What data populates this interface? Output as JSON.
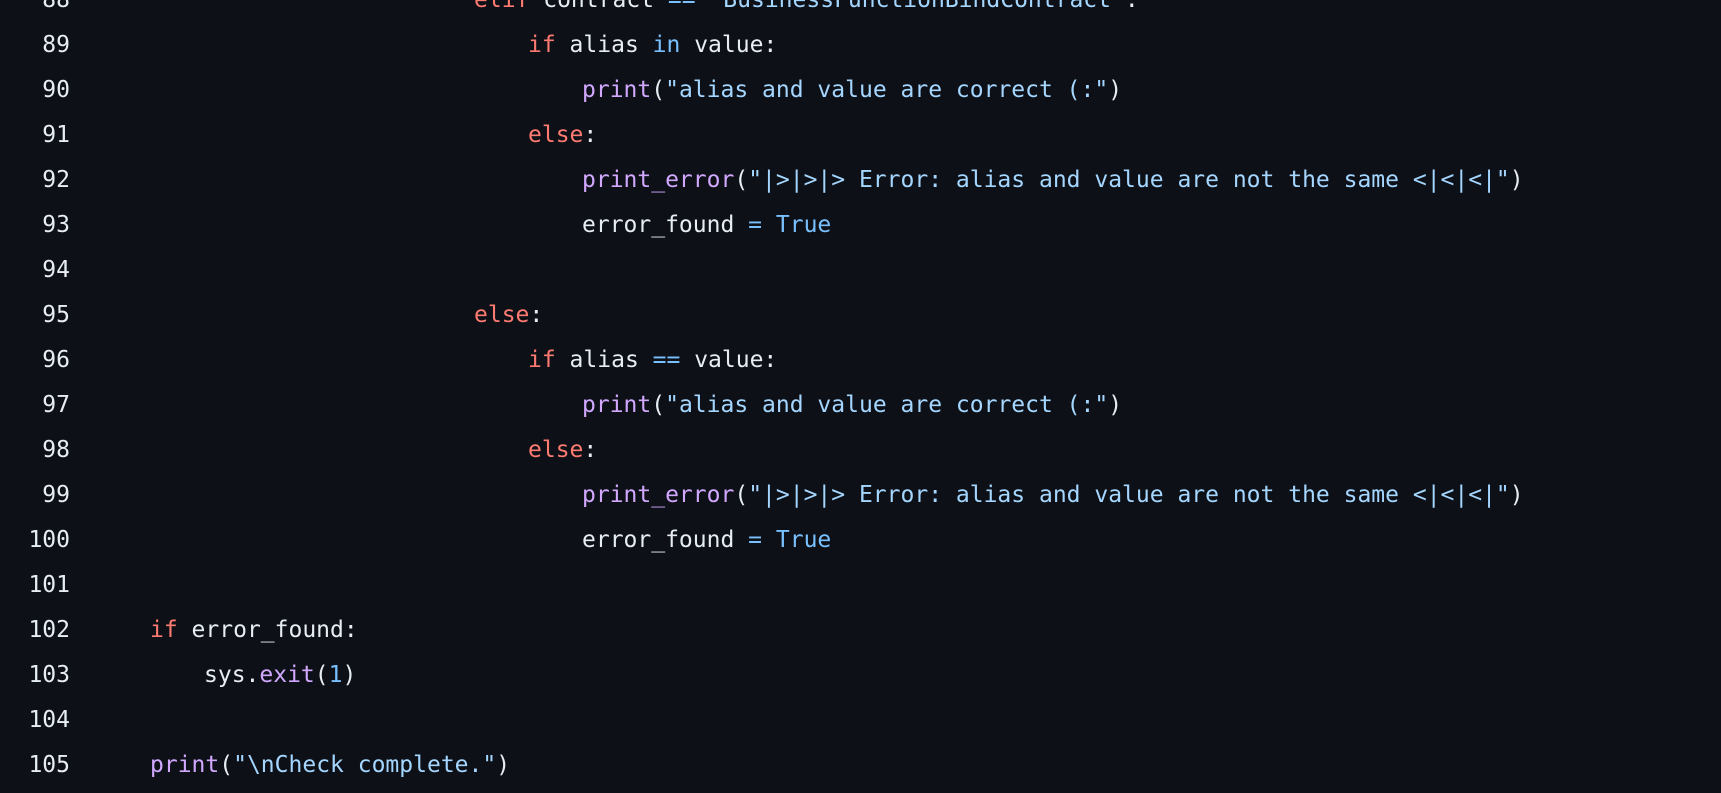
{
  "colors": {
    "background": "#0d1117",
    "text": "#e6edf3",
    "keyword": "#ff7b72",
    "function": "#d2a8ff",
    "string": "#a5d6ff",
    "constant": "#79c0ff"
  },
  "lines": [
    {
      "num": "88",
      "indent": "            ",
      "tokens": [
        [
          "kw",
          "elif"
        ],
        [
          "id",
          " contract "
        ],
        [
          "op",
          "=="
        ],
        [
          "str",
          " \"BusinessFunctionBindContract\""
        ],
        [
          "id",
          ":"
        ]
      ]
    },
    {
      "num": "89",
      "indent": "              ",
      "tokens": [
        [
          "kw",
          "if"
        ],
        [
          "id",
          " alias "
        ],
        [
          "op",
          "in"
        ],
        [
          "id",
          " value:"
        ]
      ]
    },
    {
      "num": "90",
      "indent": "                ",
      "tokens": [
        [
          "fn",
          "print"
        ],
        [
          "id",
          "("
        ],
        [
          "str",
          "\"alias and value are correct (:\""
        ],
        [
          "id",
          ")"
        ]
      ]
    },
    {
      "num": "91",
      "indent": "              ",
      "tokens": [
        [
          "kw",
          "else"
        ],
        [
          "id",
          ":"
        ]
      ]
    },
    {
      "num": "92",
      "indent": "                ",
      "tokens": [
        [
          "fn",
          "print_error"
        ],
        [
          "id",
          "("
        ],
        [
          "str",
          "\"|>|>|> Error: alias and value are not the same <|<|<|\""
        ],
        [
          "id",
          ")"
        ]
      ]
    },
    {
      "num": "93",
      "indent": "                ",
      "tokens": [
        [
          "id",
          "error_found "
        ],
        [
          "op",
          "="
        ],
        [
          "const",
          " True"
        ]
      ]
    },
    {
      "num": "94",
      "indent": "",
      "tokens": []
    },
    {
      "num": "95",
      "indent": "            ",
      "tokens": [
        [
          "kw",
          "else"
        ],
        [
          "id",
          ":"
        ]
      ]
    },
    {
      "num": "96",
      "indent": "              ",
      "tokens": [
        [
          "kw",
          "if"
        ],
        [
          "id",
          " alias "
        ],
        [
          "op",
          "=="
        ],
        [
          "id",
          " value:"
        ]
      ]
    },
    {
      "num": "97",
      "indent": "                ",
      "tokens": [
        [
          "fn",
          "print"
        ],
        [
          "id",
          "("
        ],
        [
          "str",
          "\"alias and value are correct (:\""
        ],
        [
          "id",
          ")"
        ]
      ]
    },
    {
      "num": "98",
      "indent": "              ",
      "tokens": [
        [
          "kw",
          "else"
        ],
        [
          "id",
          ":"
        ]
      ]
    },
    {
      "num": "99",
      "indent": "                ",
      "tokens": [
        [
          "fn",
          "print_error"
        ],
        [
          "id",
          "("
        ],
        [
          "str",
          "\"|>|>|> Error: alias and value are not the same <|<|<|\""
        ],
        [
          "id",
          ")"
        ]
      ]
    },
    {
      "num": "100",
      "indent": "                ",
      "tokens": [
        [
          "id",
          "error_found "
        ],
        [
          "op",
          "="
        ],
        [
          "const",
          " True"
        ]
      ]
    },
    {
      "num": "101",
      "indent": "",
      "tokens": []
    },
    {
      "num": "102",
      "indent": "",
      "tokens": [
        [
          "kw",
          "if"
        ],
        [
          "id",
          " error_found:"
        ]
      ]
    },
    {
      "num": "103",
      "indent": "  ",
      "tokens": [
        [
          "id",
          "sys."
        ],
        [
          "fn",
          "exit"
        ],
        [
          "id",
          "("
        ],
        [
          "num",
          "1"
        ],
        [
          "id",
          ")"
        ]
      ]
    },
    {
      "num": "104",
      "indent": "",
      "tokens": []
    },
    {
      "num": "105",
      "indent": "",
      "tokens": [
        [
          "fn",
          "print"
        ],
        [
          "id",
          "("
        ],
        [
          "str",
          "\"\\nCheck complete.\""
        ],
        [
          "id",
          ")"
        ]
      ]
    }
  ]
}
